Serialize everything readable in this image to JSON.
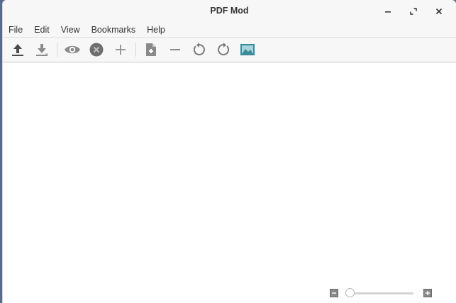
{
  "window": {
    "title": "PDF Mod"
  },
  "menubar": {
    "items": [
      {
        "label": "File"
      },
      {
        "label": "Edit"
      },
      {
        "label": "View"
      },
      {
        "label": "Bookmarks"
      },
      {
        "label": "Help"
      }
    ]
  },
  "toolbar": {
    "buttons": [
      {
        "icon": "upload-icon"
      },
      {
        "icon": "download-icon"
      },
      {
        "icon": "eye-icon"
      },
      {
        "icon": "remove-circle-icon"
      },
      {
        "icon": "plus-icon"
      },
      {
        "icon": "add-document-icon"
      },
      {
        "icon": "minus-icon"
      },
      {
        "icon": "rotate-left-icon"
      },
      {
        "icon": "rotate-right-icon"
      },
      {
        "icon": "image-icon"
      }
    ]
  },
  "zoom": {
    "level": 0.0
  },
  "colors": {
    "icon_gray": "#5e5e5e",
    "icon_image": "#3d8a9a",
    "background": "#ffffff",
    "toolbar_bg": "#f7f7f7"
  }
}
